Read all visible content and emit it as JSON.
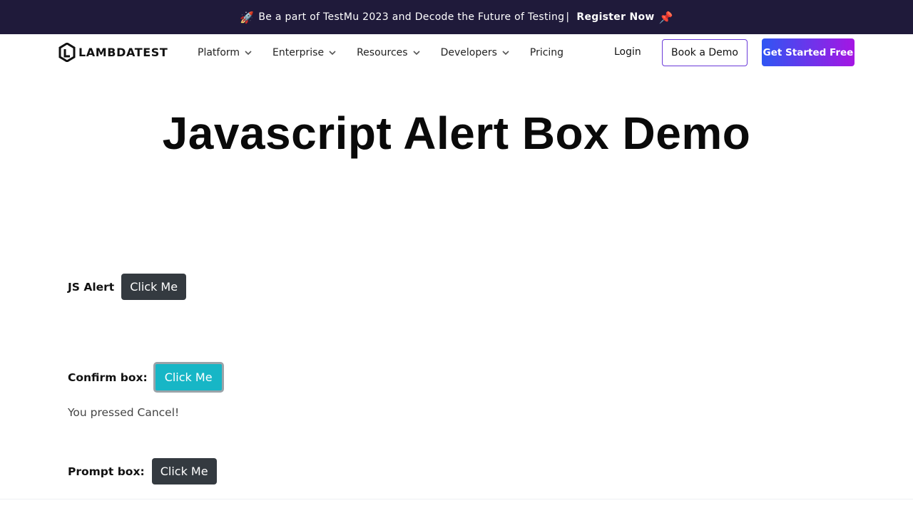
{
  "banner": {
    "rocket_emoji": "🚀",
    "text": "Be a part of TestMu 2023 and Decode the Future of Testing",
    "separator": "|",
    "register_label": "Register Now",
    "pin_emoji": "📌"
  },
  "header": {
    "logo_text": "LAMBDATEST",
    "menu": [
      {
        "label": "Platform",
        "has_dropdown": true
      },
      {
        "label": "Enterprise",
        "has_dropdown": true
      },
      {
        "label": "Resources",
        "has_dropdown": true
      },
      {
        "label": "Developers",
        "has_dropdown": true
      },
      {
        "label": "Pricing",
        "has_dropdown": false
      }
    ],
    "login_label": "Login",
    "book_demo_label": "Book a Demo",
    "get_started_label": "Get Started Free"
  },
  "main": {
    "title": "Javascript Alert Box Demo",
    "js_alert": {
      "label": "JS Alert",
      "button": "Click Me"
    },
    "confirm_box": {
      "label": "Confirm box:",
      "button": "Click Me",
      "result": "You pressed Cancel!"
    },
    "prompt_box": {
      "label": "Prompt box:",
      "button": "Click Me"
    }
  },
  "colors": {
    "banner_bg": "#1f1a3a",
    "dark_button": "#343a40",
    "teal_button": "#17b6c6",
    "gradient_start": "#2f56f3",
    "gradient_end": "#a516e3"
  },
  "icons": {
    "dropdown": "chevron-down-icon",
    "logo": "lambdatest-logo-icon"
  }
}
